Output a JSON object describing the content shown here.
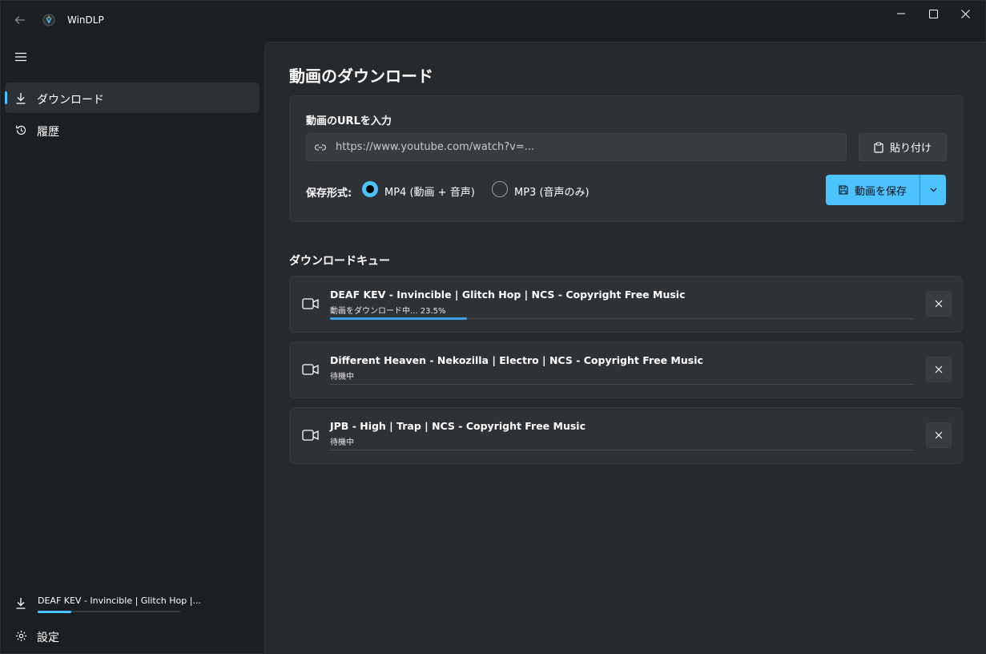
{
  "window": {
    "title": "WinDLP"
  },
  "sidebar": {
    "items": [
      {
        "label": "ダウンロード",
        "icon": "download-icon",
        "selected": true
      },
      {
        "label": "履歴",
        "icon": "history-icon",
        "selected": false
      }
    ],
    "current_download": {
      "title": "DEAF KEV - Invincible | Glitch Hop |...",
      "progress_percent": 23.5
    },
    "settings_label": "設定"
  },
  "main": {
    "page_title": "動画のダウンロード",
    "url_section": {
      "label": "動画のURLを入力",
      "url_value": "https://www.youtube.com/watch?v=...",
      "paste_button_label": "貼り付け"
    },
    "format": {
      "label": "保存形式:",
      "options": [
        {
          "label": "MP4 (動画 + 音声)",
          "selected": true
        },
        {
          "label": "MP3 (音声のみ)",
          "selected": false
        }
      ]
    },
    "save_button_label": "動画を保存",
    "queue": {
      "title": "ダウンロードキュー",
      "items": [
        {
          "title": "DEAF KEV - Invincible | Glitch Hop | NCS - Copyright Free Music",
          "status": "動画をダウンロード中... 23.5%",
          "progress_percent": 23.5
        },
        {
          "title": "Different Heaven - Nekozilla | Electro | NCS - Copyright Free Music",
          "status": "待機中",
          "progress_percent": 0
        },
        {
          "title": "JPB - High | Trap | NCS - Copyright Free Music",
          "status": "待機中",
          "progress_percent": 0
        }
      ]
    }
  },
  "colors": {
    "accent": "#4cc2ff",
    "background": "#1c1f22",
    "content": "#272a2d",
    "card": "#2e3135"
  }
}
